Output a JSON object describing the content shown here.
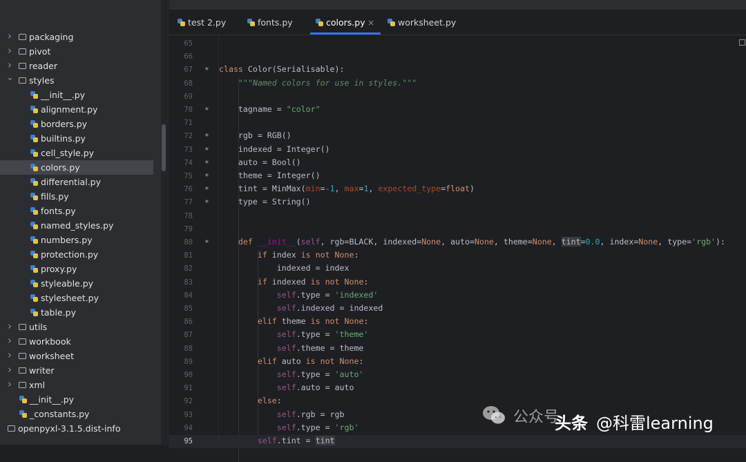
{
  "sidebar": {
    "items": [
      {
        "label": "packaging",
        "kind": "folder",
        "expanded": false
      },
      {
        "label": "pivot",
        "kind": "folder",
        "expanded": false
      },
      {
        "label": "reader",
        "kind": "folder",
        "expanded": false
      },
      {
        "label": "styles",
        "kind": "folder",
        "expanded": true
      },
      {
        "label": "__init__.py",
        "kind": "py"
      },
      {
        "label": "alignment.py",
        "kind": "py"
      },
      {
        "label": "borders.py",
        "kind": "py"
      },
      {
        "label": "builtins.py",
        "kind": "py"
      },
      {
        "label": "cell_style.py",
        "kind": "py"
      },
      {
        "label": "colors.py",
        "kind": "py",
        "selected": true
      },
      {
        "label": "differential.py",
        "kind": "py"
      },
      {
        "label": "fills.py",
        "kind": "py"
      },
      {
        "label": "fonts.py",
        "kind": "py"
      },
      {
        "label": "named_styles.py",
        "kind": "py"
      },
      {
        "label": "numbers.py",
        "kind": "py"
      },
      {
        "label": "protection.py",
        "kind": "py"
      },
      {
        "label": "proxy.py",
        "kind": "py"
      },
      {
        "label": "styleable.py",
        "kind": "py"
      },
      {
        "label": "stylesheet.py",
        "kind": "py"
      },
      {
        "label": "table.py",
        "kind": "py"
      },
      {
        "label": "utils",
        "kind": "folder",
        "expanded": false
      },
      {
        "label": "workbook",
        "kind": "folder",
        "expanded": false
      },
      {
        "label": "worksheet",
        "kind": "folder",
        "expanded": false
      },
      {
        "label": "writer",
        "kind": "folder",
        "expanded": false
      },
      {
        "label": "xml",
        "kind": "folder",
        "expanded": false
      },
      {
        "label": "__init__.py",
        "kind": "py"
      },
      {
        "label": "_constants.py",
        "kind": "py"
      },
      {
        "label": "openpyxl-3.1.5.dist-info",
        "kind": "folder"
      }
    ]
  },
  "tabs": [
    {
      "label": "test 2.py",
      "active": false
    },
    {
      "label": "fonts.py",
      "active": false
    },
    {
      "label": "colors.py",
      "active": true,
      "close": "×"
    },
    {
      "label": "worksheet.py",
      "active": false
    }
  ],
  "editor": {
    "current_line": 95,
    "lines": [
      {
        "n": "65",
        "marker": "",
        "tokens": []
      },
      {
        "n": "66",
        "marker": "",
        "tokens": []
      },
      {
        "n": "67",
        "marker": "*",
        "tokens": [
          [
            "kw",
            "class "
          ],
          [
            "p",
            "Color(Serialisable):"
          ]
        ]
      },
      {
        "n": "68",
        "marker": "",
        "tokens": [
          [
            "p",
            "    "
          ],
          [
            "doc",
            "\"\"\"Named colors for use in styles.\"\"\""
          ]
        ]
      },
      {
        "n": "69",
        "marker": "",
        "tokens": []
      },
      {
        "n": "70",
        "marker": "*",
        "tokens": [
          [
            "p",
            "    tagname = "
          ],
          [
            "str",
            "\"color\""
          ]
        ]
      },
      {
        "n": "71",
        "marker": "",
        "tokens": []
      },
      {
        "n": "72",
        "marker": "*",
        "tokens": [
          [
            "p",
            "    rgb = RGB()"
          ]
        ]
      },
      {
        "n": "73",
        "marker": "*",
        "tokens": [
          [
            "p",
            "    indexed = Integer()"
          ]
        ]
      },
      {
        "n": "74",
        "marker": "*",
        "tokens": [
          [
            "p",
            "    auto = Bool()"
          ]
        ]
      },
      {
        "n": "75",
        "marker": "*",
        "tokens": [
          [
            "p",
            "    theme = Integer()"
          ]
        ]
      },
      {
        "n": "76",
        "marker": "*",
        "tokens": [
          [
            "p",
            "    tint = MinMax("
          ],
          [
            "kwarg",
            "min"
          ],
          [
            "p",
            "="
          ],
          [
            "num",
            "-1"
          ],
          [
            "p",
            ", "
          ],
          [
            "kwarg",
            "max"
          ],
          [
            "p",
            "="
          ],
          [
            "num",
            "1"
          ],
          [
            "p",
            ", "
          ],
          [
            "kwarg",
            "expected_type"
          ],
          [
            "p",
            "="
          ],
          [
            "kw",
            "float"
          ],
          [
            "p",
            ")"
          ]
        ]
      },
      {
        "n": "77",
        "marker": "*",
        "tokens": [
          [
            "p",
            "    type = String()"
          ]
        ]
      },
      {
        "n": "78",
        "marker": "",
        "tokens": []
      },
      {
        "n": "79",
        "marker": "",
        "tokens": []
      },
      {
        "n": "80",
        "marker": "*",
        "tokens": [
          [
            "p",
            "    "
          ],
          [
            "kw",
            "def "
          ],
          [
            "magic",
            "__init__"
          ],
          [
            "p",
            "("
          ],
          [
            "slf",
            "self"
          ],
          [
            "p",
            ", rgb=BLACK, indexed="
          ],
          [
            "kw",
            "None"
          ],
          [
            "p",
            ", auto="
          ],
          [
            "kw",
            "None"
          ],
          [
            "p",
            ", theme="
          ],
          [
            "kw",
            "None"
          ],
          [
            "p",
            ", "
          ],
          [
            "hl",
            "tint"
          ],
          [
            "p",
            "="
          ],
          [
            "num",
            "0.0"
          ],
          [
            "p",
            ", index="
          ],
          [
            "kw",
            "None"
          ],
          [
            "p",
            ", type="
          ],
          [
            "str",
            "'rgb'"
          ],
          [
            "p",
            "):"
          ]
        ]
      },
      {
        "n": "81",
        "marker": "",
        "tokens": [
          [
            "p",
            "        "
          ],
          [
            "kw",
            "if "
          ],
          [
            "p",
            "index "
          ],
          [
            "kw",
            "is not None"
          ],
          [
            "p",
            ":"
          ]
        ]
      },
      {
        "n": "82",
        "marker": "",
        "tokens": [
          [
            "p",
            "            indexed = index"
          ]
        ]
      },
      {
        "n": "83",
        "marker": "",
        "tokens": [
          [
            "p",
            "        "
          ],
          [
            "kw",
            "if "
          ],
          [
            "p",
            "indexed "
          ],
          [
            "kw",
            "is not None"
          ],
          [
            "p",
            ":"
          ]
        ]
      },
      {
        "n": "84",
        "marker": "",
        "tokens": [
          [
            "p",
            "            "
          ],
          [
            "slf",
            "self"
          ],
          [
            "p",
            ".type = "
          ],
          [
            "str",
            "'indexed'"
          ]
        ]
      },
      {
        "n": "85",
        "marker": "",
        "tokens": [
          [
            "p",
            "            "
          ],
          [
            "slf",
            "self"
          ],
          [
            "p",
            ".indexed = indexed"
          ]
        ]
      },
      {
        "n": "86",
        "marker": "",
        "tokens": [
          [
            "p",
            "        "
          ],
          [
            "kw",
            "elif "
          ],
          [
            "p",
            "theme "
          ],
          [
            "kw",
            "is not None"
          ],
          [
            "p",
            ":"
          ]
        ]
      },
      {
        "n": "87",
        "marker": "",
        "tokens": [
          [
            "p",
            "            "
          ],
          [
            "slf",
            "self"
          ],
          [
            "p",
            ".type = "
          ],
          [
            "str",
            "'theme'"
          ]
        ]
      },
      {
        "n": "88",
        "marker": "",
        "tokens": [
          [
            "p",
            "            "
          ],
          [
            "slf",
            "self"
          ],
          [
            "p",
            ".theme = theme"
          ]
        ]
      },
      {
        "n": "89",
        "marker": "",
        "tokens": [
          [
            "p",
            "        "
          ],
          [
            "kw",
            "elif "
          ],
          [
            "p",
            "auto "
          ],
          [
            "kw",
            "is not None"
          ],
          [
            "p",
            ":"
          ]
        ]
      },
      {
        "n": "90",
        "marker": "",
        "tokens": [
          [
            "p",
            "            "
          ],
          [
            "slf",
            "self"
          ],
          [
            "p",
            ".type = "
          ],
          [
            "str",
            "'auto'"
          ]
        ]
      },
      {
        "n": "91",
        "marker": "",
        "tokens": [
          [
            "p",
            "            "
          ],
          [
            "slf",
            "self"
          ],
          [
            "p",
            ".auto = auto"
          ]
        ]
      },
      {
        "n": "92",
        "marker": "",
        "tokens": [
          [
            "p",
            "        "
          ],
          [
            "kw",
            "else"
          ],
          [
            "p",
            ":"
          ]
        ]
      },
      {
        "n": "93",
        "marker": "",
        "tokens": [
          [
            "p",
            "            "
          ],
          [
            "slf",
            "self"
          ],
          [
            "p",
            ".rgb = rgb"
          ]
        ]
      },
      {
        "n": "94",
        "marker": "",
        "tokens": [
          [
            "p",
            "            "
          ],
          [
            "slf",
            "self"
          ],
          [
            "p",
            ".type = "
          ],
          [
            "str",
            "'rgb'"
          ]
        ]
      },
      {
        "n": "95",
        "marker": "",
        "tokens": [
          [
            "p",
            "        "
          ],
          [
            "slf",
            "self"
          ],
          [
            "p",
            ".tint = "
          ],
          [
            "hl",
            "tint"
          ]
        ]
      }
    ]
  },
  "watermark": {
    "wechat": "公众号",
    "toutiao": "头条",
    "handle": "@科雷learning"
  },
  "icons": {
    "folder": "folder-icon",
    "python_file": "python-file-icon",
    "chevron_right": "chevron-right-icon",
    "chevron_down": "chevron-down-icon",
    "wechat": "wechat-icon"
  },
  "colors": {
    "background": "#1e1f22",
    "sidebar": "#2b2d30",
    "accent": "#3574f0",
    "keyword": "#cf8e6d",
    "string": "#6aab73",
    "number": "#2aacb8"
  }
}
